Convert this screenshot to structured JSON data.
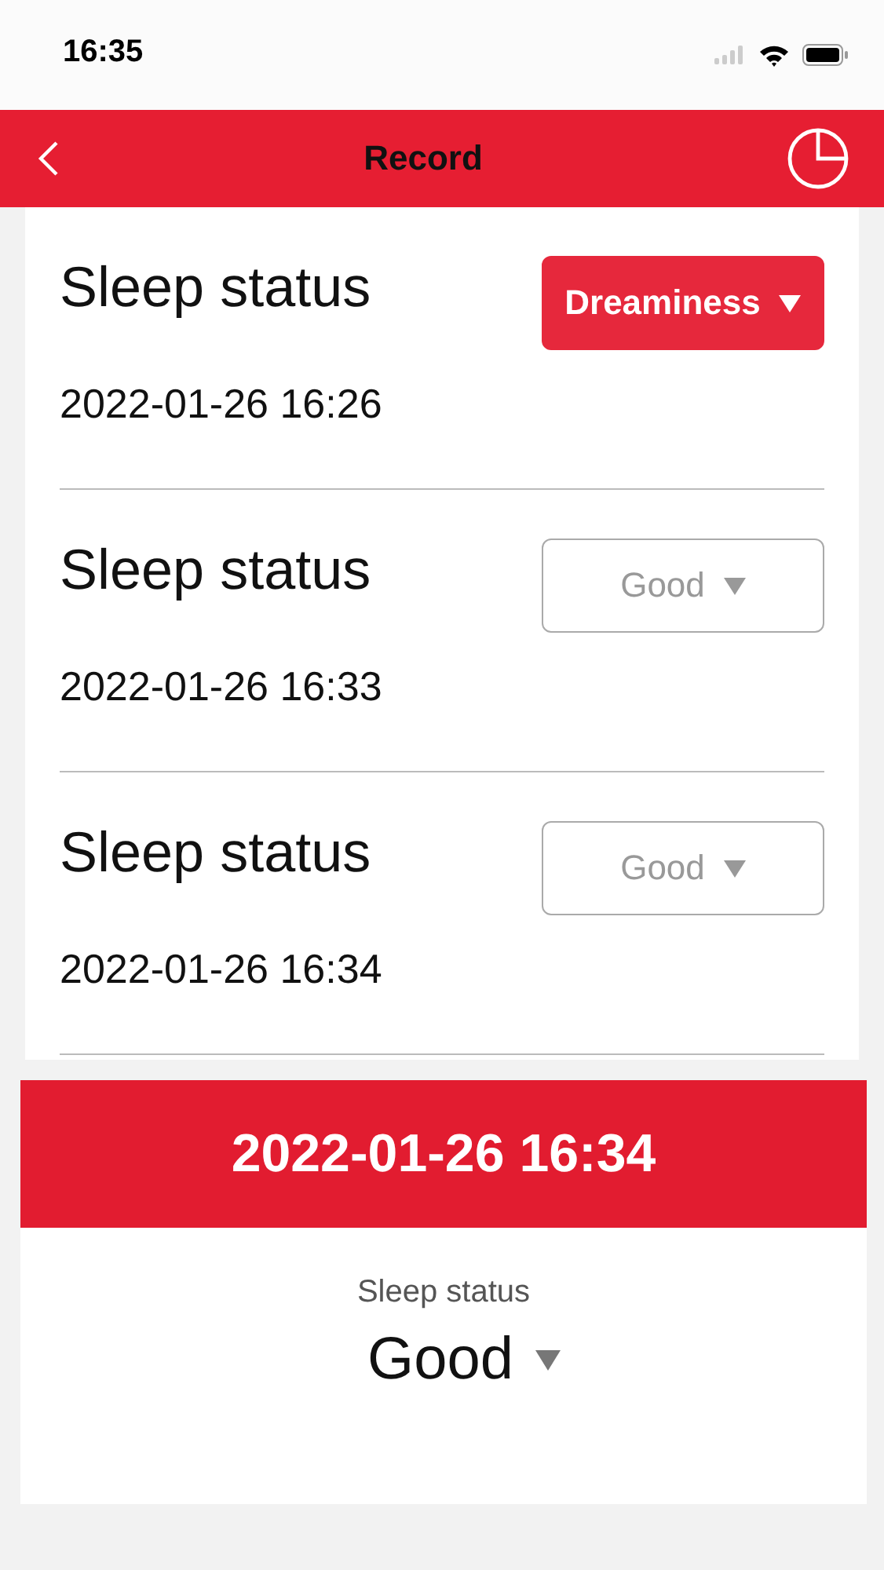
{
  "status_bar": {
    "time": "16:35"
  },
  "nav": {
    "title": "Record"
  },
  "records": [
    {
      "label": "Sleep status",
      "time": "2022-01-26 16:26",
      "status": "Dreaminess",
      "selected": true
    },
    {
      "label": "Sleep status",
      "time": "2022-01-26 16:33",
      "status": "Good",
      "selected": false
    },
    {
      "label": "Sleep status",
      "time": "2022-01-26 16:34",
      "status": "Good",
      "selected": false
    }
  ],
  "detail": {
    "time": "2022-01-26 16:34",
    "label": "Sleep status",
    "value": "Good"
  }
}
